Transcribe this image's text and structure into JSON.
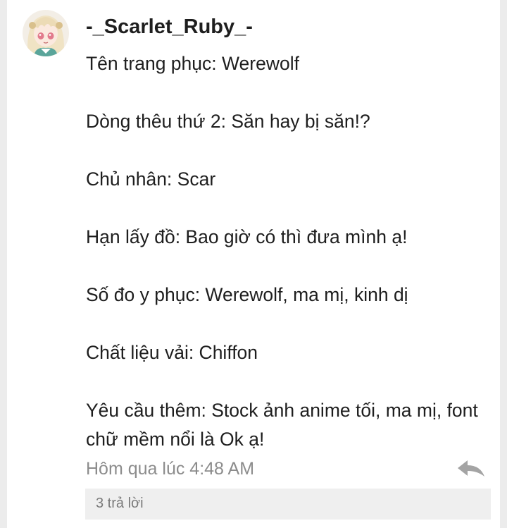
{
  "comment": {
    "username": "-_Scarlet_Ruby_-",
    "lines": [
      "Tên trang phục: Werewolf",
      "Dòng thêu thứ 2: Săn hay bị săn!?",
      "Chủ nhân: Scar",
      "Hạn lấy đồ: Bao giờ có thì đưa mình ạ!",
      "Số đo y phục: Werewolf, ma mị, kinh dị",
      "Chất liệu vải: Chiffon",
      "Yêu cầu thêm: Stock ảnh anime tối, ma mị, font chữ mềm nổi là Ok ạ!"
    ],
    "timestamp": "Hôm qua lúc 4:48 AM",
    "replies_label": "3 trả lời",
    "reply_icon": "reply-arrow-icon"
  }
}
